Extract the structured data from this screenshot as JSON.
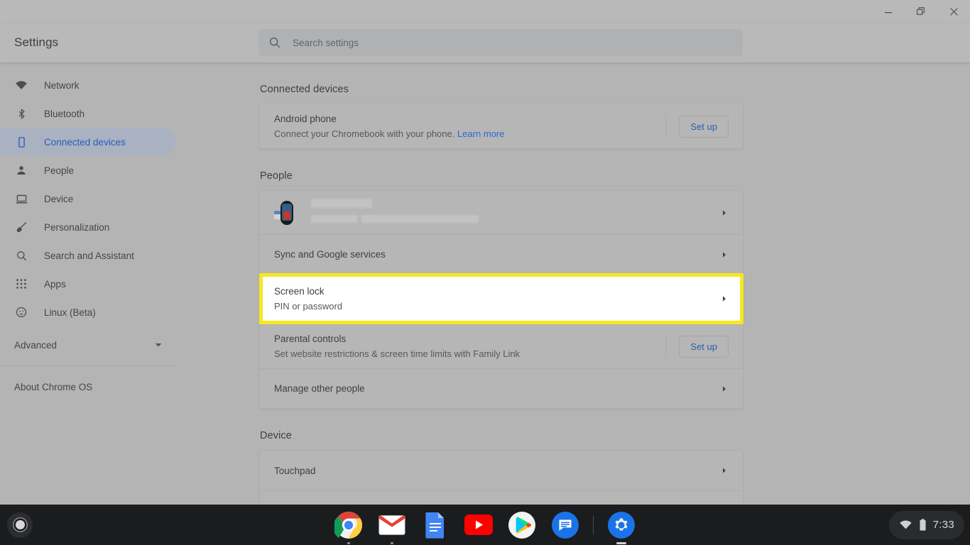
{
  "window": {
    "controls": [
      {
        "name": "minimize",
        "label": "Minimize"
      },
      {
        "name": "restore",
        "label": "Restore"
      },
      {
        "name": "close",
        "label": "Close"
      }
    ]
  },
  "header": {
    "title": "Settings",
    "search": {
      "placeholder": "Search settings",
      "value": "",
      "icon": "search-icon"
    }
  },
  "sidebar": {
    "items": [
      {
        "label": "Network",
        "icon": "wifi-icon",
        "selected": false
      },
      {
        "label": "Bluetooth",
        "icon": "bluetooth-icon",
        "selected": false
      },
      {
        "label": "Connected devices",
        "icon": "phone-icon",
        "selected": true
      },
      {
        "label": "People",
        "icon": "person-icon",
        "selected": false
      },
      {
        "label": "Device",
        "icon": "laptop-icon",
        "selected": false
      },
      {
        "label": "Personalization",
        "icon": "brush-icon",
        "selected": false
      },
      {
        "label": "Search and Assistant",
        "icon": "search-icon",
        "selected": false
      },
      {
        "label": "Apps",
        "icon": "grid-icon",
        "selected": false
      },
      {
        "label": "Linux (Beta)",
        "icon": "linux-icon",
        "selected": false
      }
    ],
    "advanced": {
      "label": "Advanced",
      "icon": "chevron-down-icon"
    },
    "about": {
      "label": "About Chrome OS"
    }
  },
  "main": {
    "sections": [
      {
        "title": "Connected devices",
        "rows": [
          {
            "title": "Android phone",
            "sub": "Connect your Chromebook with your phone.",
            "link": "Learn more",
            "action": "Set up",
            "chevron": false
          }
        ]
      },
      {
        "title": "People",
        "rows": [
          {
            "title": "",
            "sub": "",
            "account_redacted": true,
            "chevron": true
          },
          {
            "title": "Sync and Google services",
            "sub": "",
            "chevron": true
          },
          {
            "title": "Screen lock",
            "sub": "PIN or password",
            "chevron": true,
            "highlighted": true
          },
          {
            "title": "Parental controls",
            "sub": "Set website restrictions & screen time limits with Family Link",
            "action": "Set up",
            "chevron": false
          },
          {
            "title": "Manage other people",
            "sub": "",
            "chevron": true
          }
        ]
      },
      {
        "title": "Device",
        "rows": [
          {
            "title": "Touchpad",
            "sub": "",
            "chevron": true
          }
        ]
      }
    ]
  },
  "shelf": {
    "launcher": {
      "name": "launcher-button"
    },
    "apps": [
      {
        "name": "chrome",
        "label": "Google Chrome",
        "running": true,
        "active": false
      },
      {
        "name": "gmail",
        "label": "Gmail",
        "running": true,
        "active": false
      },
      {
        "name": "docs",
        "label": "Google Docs",
        "running": false,
        "active": false
      },
      {
        "name": "youtube",
        "label": "YouTube",
        "running": false,
        "active": false
      },
      {
        "name": "play-store",
        "label": "Play Store",
        "running": false,
        "active": false
      },
      {
        "name": "messages",
        "label": "Messages",
        "running": false,
        "active": false
      },
      {
        "name": "settings",
        "label": "Settings",
        "running": true,
        "active": true
      }
    ],
    "tray": {
      "clock": "7:33",
      "wifi_icon": "wifi-icon",
      "battery_icon": "battery-icon"
    }
  },
  "colors": {
    "highlight": "#f7e81f",
    "accent": "#2a5fae",
    "link": "#2a6bd1",
    "background": "#b4b4b4",
    "shelf": "#1b1c1e"
  }
}
